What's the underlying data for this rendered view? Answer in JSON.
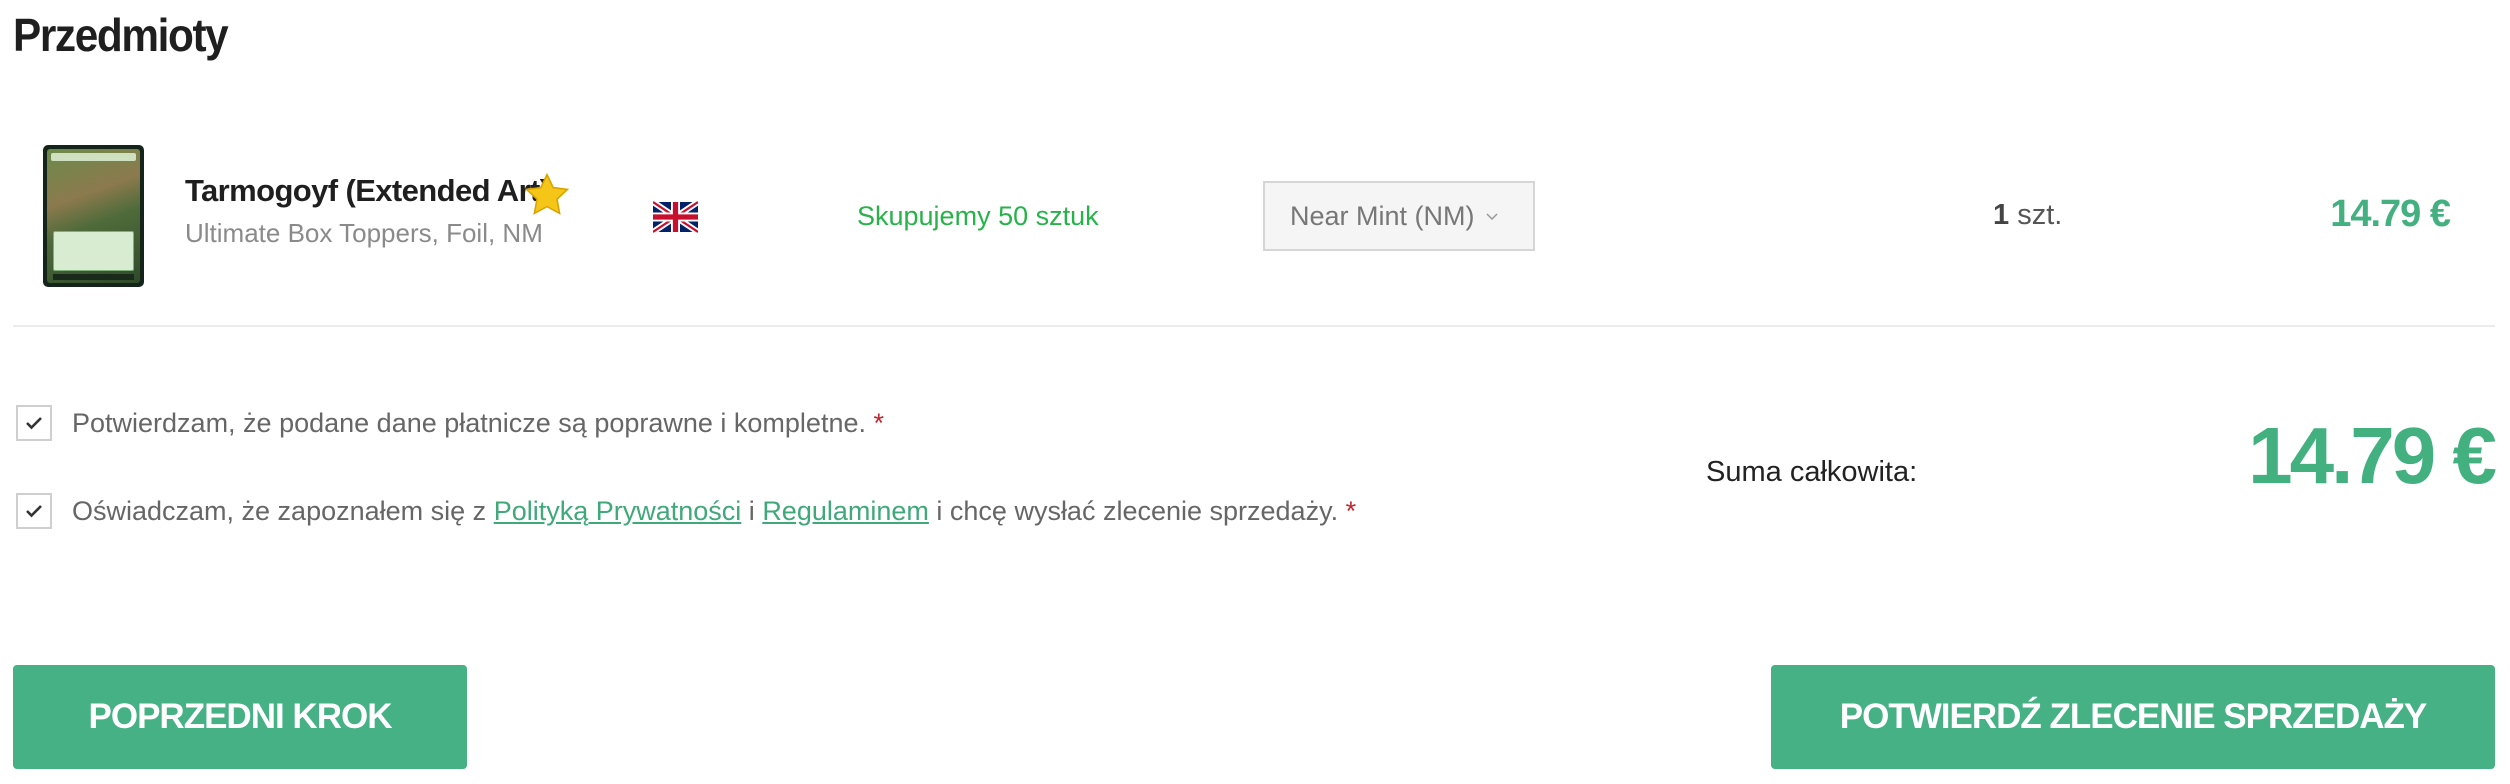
{
  "page": {
    "title": "Przedmioty"
  },
  "item": {
    "name": "Tarmogoyf (Extended Art)",
    "subtitle": "Ultimate Box Toppers, Foil, NM",
    "buying_note": "Skupujemy 50 sztuk",
    "condition": "Near Mint (NM)",
    "quantity": "1",
    "quantity_unit": "szt.",
    "price": "14.79 €",
    "icons": {
      "favorite": "star-icon",
      "language": "uk-flag-icon",
      "select": "chevron-down-icon"
    }
  },
  "confirmations": {
    "payment_data": {
      "text": "Potwierdzam, że podane dane płatnicze są poprawne i kompletne.",
      "required_mark": "*",
      "checked": true
    },
    "terms": {
      "text_before": "Oświadczam, że zapoznałem się z",
      "privacy_link": "Polityką Prywatności",
      "conjunction": "i",
      "terms_link": "Regulaminem",
      "text_after": "i chcę wysłać zlecenie sprzedaży.",
      "required_mark": "*",
      "checked": true
    }
  },
  "summary": {
    "total_label": "Suma całkowita:",
    "total_value": "14.79 €"
  },
  "buttons": {
    "previous": "POPRZEDNI KROK",
    "confirm": "POTWIERDŹ ZLECENIE SPRZEDAŻY"
  },
  "colors": {
    "accent": "#46b185",
    "price": "#43b080",
    "buying": "#27b24a",
    "required": "#c0262d"
  }
}
